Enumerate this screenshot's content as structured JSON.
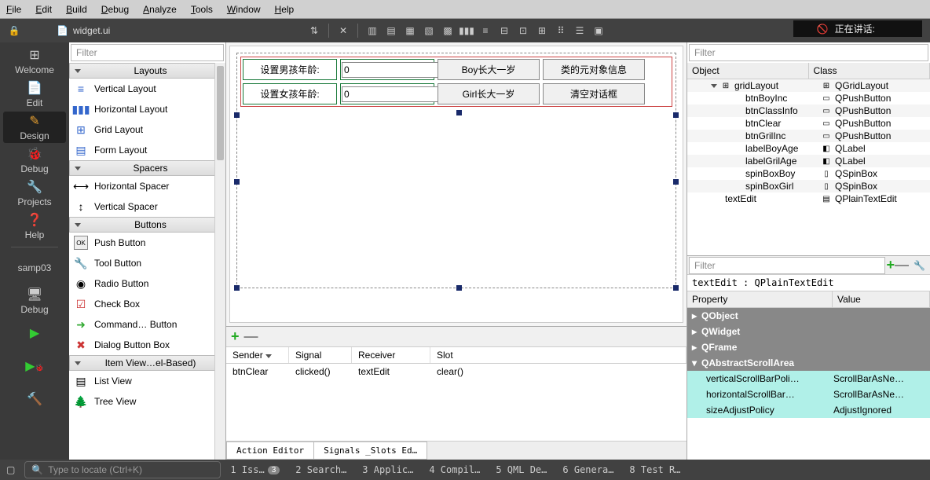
{
  "menu": {
    "file": "File",
    "edit": "Edit",
    "build": "Build",
    "debug": "Debug",
    "analyze": "Analyze",
    "tools": "Tools",
    "window": "Window",
    "help": "Help"
  },
  "talking": "正在讲话:",
  "file_tab": "widget.ui",
  "modes": {
    "welcome": "Welcome",
    "edit": "Edit",
    "design": "Design",
    "debug": "Debug",
    "projects": "Projects",
    "help": "Help",
    "samp": "samp03",
    "debug2": "Debug"
  },
  "widgetbox": {
    "filter": "Filter",
    "cats": {
      "layouts": "Layouts",
      "spacers": "Spacers",
      "buttons": "Buttons",
      "itemviews": "Item View…el-Based)"
    },
    "items": {
      "vlayout": "Vertical Layout",
      "hlayout": "Horizontal Layout",
      "gridlayout": "Grid Layout",
      "formlayout": "Form Layout",
      "hspacer": "Horizontal Spacer",
      "vspacer": "Vertical Spacer",
      "pushbtn": "Push Button",
      "toolbtn": "Tool Button",
      "radiobtn": "Radio Button",
      "checkbox": "Check Box",
      "cmdbtn": "Command… Button",
      "dlgbtnbox": "Dialog Button Box",
      "listview": "List View",
      "treeview": "Tree View"
    }
  },
  "form": {
    "labelBoy": "设置男孩年龄:",
    "labelGirl": "设置女孩年龄:",
    "spinBoy": "0",
    "spinGirl": "0",
    "btnBoy": "Boy长大一岁",
    "btnGirl": "Girl长大一岁",
    "btnClassInfo": "类的元对象信息",
    "btnClear": "清空对话框"
  },
  "signals": {
    "headers": {
      "sender": "Sender",
      "signal": "Signal",
      "receiver": "Receiver",
      "slot": "Slot"
    },
    "row": {
      "sender": "btnClear",
      "signal": "clicked()",
      "receiver": "textEdit",
      "slot": "clear()"
    },
    "tabs": {
      "action": "Action Editor",
      "signals": "Signals _Slots Ed…"
    }
  },
  "objects": {
    "filter": "Filter",
    "headers": {
      "object": "Object",
      "class": "Class"
    },
    "rows": [
      {
        "name": "gridLayout",
        "cls": "QGridLayout",
        "indent": 30,
        "icon": "⊞",
        "cicon": "⊞"
      },
      {
        "name": "btnBoyInc",
        "cls": "QPushButton",
        "indent": 56,
        "cicon": "▭"
      },
      {
        "name": "btnClassInfo",
        "cls": "QPushButton",
        "indent": 56,
        "cicon": "▭"
      },
      {
        "name": "btnClear",
        "cls": "QPushButton",
        "indent": 56,
        "cicon": "▭"
      },
      {
        "name": "btnGrilInc",
        "cls": "QPushButton",
        "indent": 56,
        "cicon": "▭"
      },
      {
        "name": "labelBoyAge",
        "cls": "QLabel",
        "indent": 56,
        "cicon": "◧"
      },
      {
        "name": "labelGrilAge",
        "cls": "QLabel",
        "indent": 56,
        "cicon": "◧"
      },
      {
        "name": "spinBoxBoy",
        "cls": "QSpinBox",
        "indent": 56,
        "cicon": "▯"
      },
      {
        "name": "spinBoxGirl",
        "cls": "QSpinBox",
        "indent": 56,
        "cicon": "▯"
      },
      {
        "name": "textEdit",
        "cls": "QPlainTextEdit",
        "indent": 30,
        "cicon": "▤"
      }
    ]
  },
  "props": {
    "filter": "Filter",
    "path": "textEdit : QPlainTextEdit",
    "headers": {
      "property": "Property",
      "value": "Value"
    },
    "groups": [
      "QObject",
      "QWidget",
      "QFrame",
      "QAbstractScrollArea"
    ],
    "rows": [
      {
        "name": "verticalScrollBarPoli…",
        "value": "ScrollBarAsNe…",
        "hl": true
      },
      {
        "name": "horizontalScrollBar…",
        "value": "ScrollBarAsNe…",
        "hl": true
      },
      {
        "name": "sizeAdjustPolicy",
        "value": "AdjustIgnored",
        "hl": true
      }
    ]
  },
  "status": {
    "locator": "Type to locate (Ctrl+K)",
    "items": [
      {
        "n": "1",
        "t": "Iss…",
        "b": "3"
      },
      {
        "n": "2",
        "t": "Search…"
      },
      {
        "n": "3",
        "t": "Applic…"
      },
      {
        "n": "4",
        "t": "Compil…"
      },
      {
        "n": "5",
        "t": "QML De…"
      },
      {
        "n": "6",
        "t": "Genera…"
      },
      {
        "n": "8",
        "t": "Test R…"
      }
    ]
  }
}
